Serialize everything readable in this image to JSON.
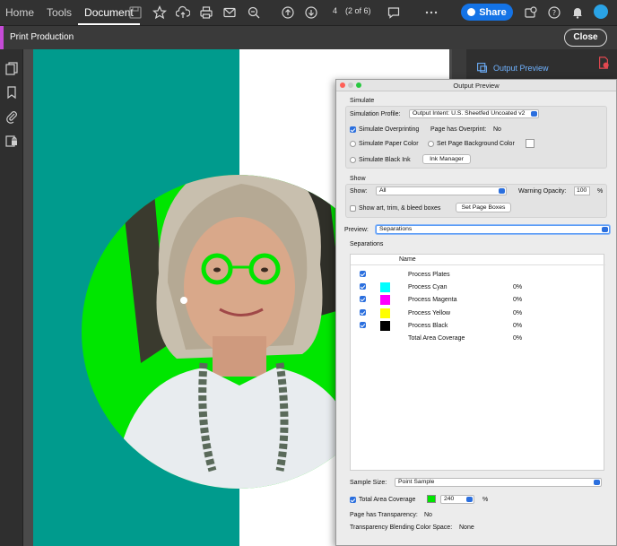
{
  "nav": {
    "tabs": [
      {
        "label": "Home"
      },
      {
        "label": "Tools"
      },
      {
        "label": "Document"
      }
    ],
    "page_number": "4",
    "page_of": "(2 of 6)",
    "share_label": "Share"
  },
  "subbar": {
    "title": "Print Production",
    "close_label": "Close"
  },
  "right_panel": {
    "output_preview_label": "Output Preview"
  },
  "dialog": {
    "title": "Output Preview",
    "simulate": {
      "header": "Simulate",
      "profile_label": "Simulation Profile:",
      "profile_value": "Output Intent: U.S. Sheetfed Uncoated v2",
      "simulate_overprinting": "Simulate Overprinting",
      "page_has_overprint_label": "Page has Overprint:",
      "page_has_overprint_value": "No",
      "simulate_paper_color": "Simulate Paper Color",
      "set_page_bg_color": "Set Page Background Color",
      "simulate_black_ink": "Simulate Black Ink",
      "ink_manager": "Ink Manager"
    },
    "show": {
      "header": "Show",
      "show_label": "Show:",
      "show_value": "All",
      "warning_opacity_label": "Warning Opacity:",
      "warning_opacity_value": "100",
      "percent": "%",
      "show_art_trim": "Show art, trim, & bleed boxes",
      "set_page_boxes": "Set Page Boxes"
    },
    "preview": {
      "label": "Preview:",
      "value": "Separations"
    },
    "separations": {
      "header": "Separations",
      "column_name": "Name",
      "rows": [
        {
          "name": "Process Plates",
          "value": "",
          "color": ""
        },
        {
          "name": "Process Cyan",
          "value": "0%",
          "color": "#00ffff"
        },
        {
          "name": "Process Magenta",
          "value": "0%",
          "color": "#ff00ff"
        },
        {
          "name": "Process Yellow",
          "value": "0%",
          "color": "#ffff00"
        },
        {
          "name": "Process Black",
          "value": "0%",
          "color": "#000000"
        },
        {
          "name": "Total Area Coverage",
          "value": "0%",
          "color": ""
        }
      ]
    },
    "footer": {
      "sample_size_label": "Sample Size:",
      "sample_size_value": "Point Sample",
      "total_area_coverage_label": "Total Area Coverage",
      "tac_value": "240",
      "percent": "%",
      "transparency_label": "Page has Transparency:",
      "transparency_value": "No",
      "blending_label": "Transparency Blending Color Space:",
      "blending_value": "None"
    }
  },
  "colors": {
    "teal": "#009b8d",
    "green_highlight": "#00e600",
    "accent": "#1473e6"
  }
}
